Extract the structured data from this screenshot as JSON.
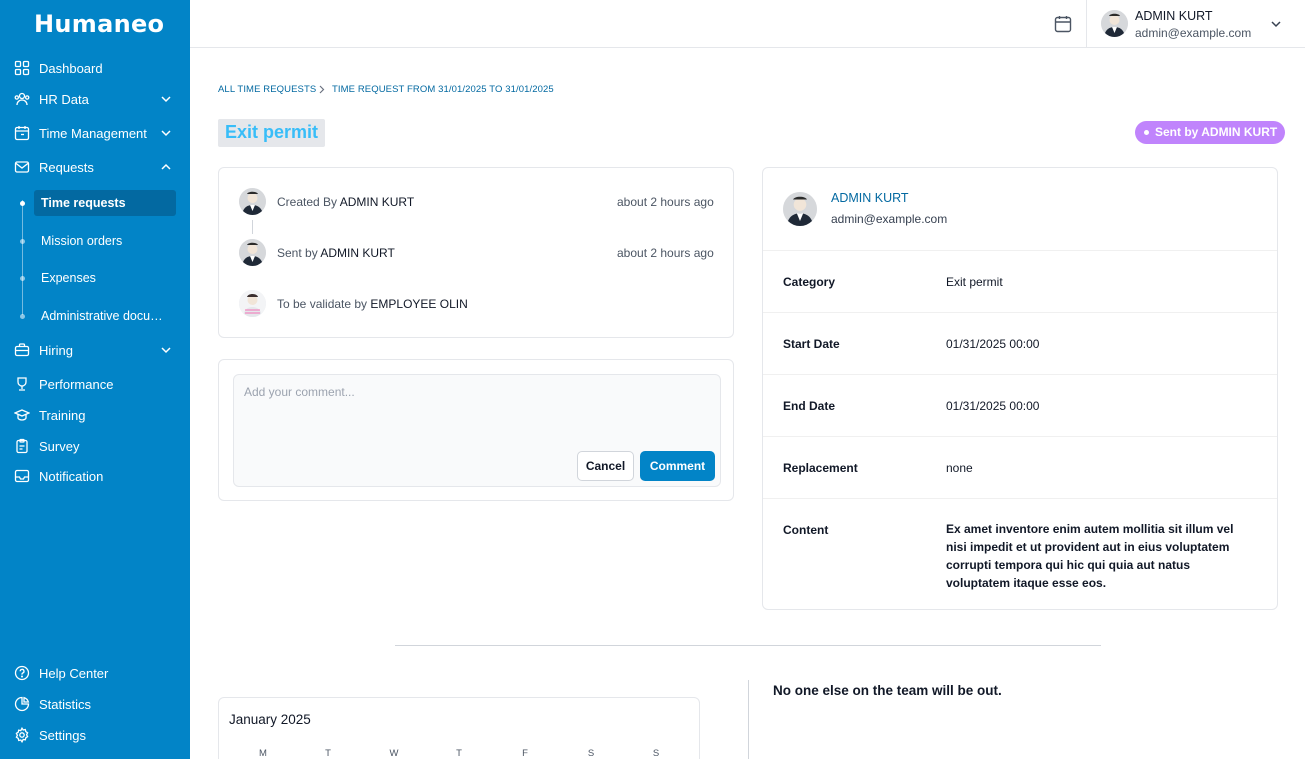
{
  "brand": "Humaneo",
  "sidebar": {
    "items": [
      {
        "label": "Dashboard",
        "icon": "dashboard-grid-icon"
      },
      {
        "label": "HR Data",
        "icon": "users-icon"
      },
      {
        "label": "Time Management",
        "icon": "calendar-clock-icon"
      },
      {
        "label": "Requests",
        "icon": "mail-icon"
      },
      {
        "label": "Hiring",
        "icon": "briefcase-icon"
      },
      {
        "label": "Performance",
        "icon": "trophy-icon"
      },
      {
        "label": "Training",
        "icon": "graduation-cap-icon"
      },
      {
        "label": "Survey",
        "icon": "clipboard-icon"
      },
      {
        "label": "Notification",
        "icon": "inbox-icon"
      }
    ],
    "sub_items": [
      "Time requests",
      "Mission orders",
      "Expenses",
      "Administrative documents"
    ],
    "active_sub": "Time requests",
    "bottom": [
      {
        "label": "Help Center",
        "icon": "help-circle-icon"
      },
      {
        "label": "Statistics",
        "icon": "pie-chart-icon"
      },
      {
        "label": "Settings",
        "icon": "gear-icon"
      }
    ]
  },
  "topbar": {
    "user_name": "ADMIN KURT",
    "user_email": "admin@example.com"
  },
  "breadcrumb": {
    "parent": "ALL TIME REQUESTS",
    "current": "TIME REQUEST FROM 31/01/2025 TO 31/01/2025"
  },
  "page": {
    "title": "Exit permit",
    "status": "Sent by ADMIN KURT"
  },
  "timeline": [
    {
      "prefix": "Created By",
      "name": "ADMIN KURT",
      "time": "about 2 hours ago"
    },
    {
      "prefix": "Sent by",
      "name": "ADMIN KURT",
      "time": "about 2 hours ago"
    },
    {
      "prefix": "To be validate by",
      "name": "EMPLOYEE OLIN",
      "time": ""
    }
  ],
  "comment": {
    "placeholder": "Add your comment...",
    "cancel_label": "Cancel",
    "submit_label": "Comment"
  },
  "details": {
    "user_name": "ADMIN KURT",
    "user_email": "admin@example.com",
    "rows": [
      {
        "label": "Category",
        "value": "Exit permit"
      },
      {
        "label": "Start Date",
        "value": "01/31/2025 00:00"
      },
      {
        "label": "End Date",
        "value": "01/31/2025 00:00"
      },
      {
        "label": "Replacement",
        "value": "none"
      },
      {
        "label": "Content",
        "value": "Ex amet inventore enim autem mollitia sit illum vel nisi impedit et ut provident aut in eius voluptatem corrupti tempora qui hic qui quia aut natus voluptatem itaque esse eos."
      }
    ]
  },
  "calendar": {
    "month": "January 2025",
    "weekdays": [
      "M",
      "T",
      "W",
      "T",
      "F",
      "S",
      "S"
    ]
  },
  "team_message": "No one else on the team will be out.",
  "colors": {
    "sidebar_bg": "#0284c7",
    "accent": "#0284c7",
    "status_badge": "#c084fc",
    "title_text": "#38bdf8"
  }
}
